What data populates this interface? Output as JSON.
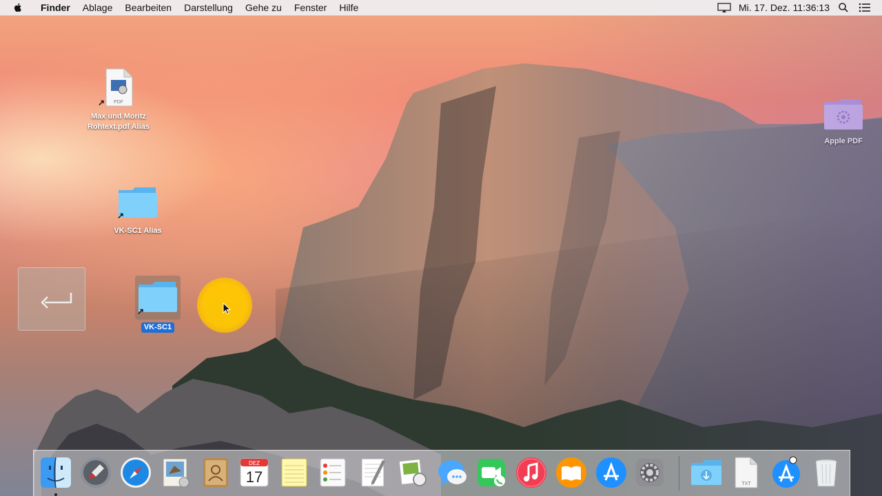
{
  "menubar": {
    "apple_icon": "apple-logo-icon",
    "items": [
      "Finder",
      "Ablage",
      "Bearbeiten",
      "Darstellung",
      "Gehe zu",
      "Fenster",
      "Hilfe"
    ],
    "clock": "Mi. 17. Dez.  11:36:13"
  },
  "desktop": {
    "pdf_alias": {
      "label": "Max und Moritz\nRohtext.pdf Alias",
      "badge": "PDF"
    },
    "folder_alias": {
      "label": "VK-SC1 Alias"
    },
    "folder_selected": {
      "label": "VK-SC1"
    },
    "apple_pdf": {
      "label": "Apple PDF"
    }
  },
  "dock": {
    "calendar_month": "DEZ",
    "calendar_day": "17",
    "txt_badge": "TXT",
    "items": [
      "Finder",
      "Launchpad",
      "Safari",
      "Mail",
      "Kontakte",
      "Kalender",
      "Notizen",
      "Erinnerungen",
      "TextEdit",
      "Vorschau",
      "Nachrichten",
      "FaceTime",
      "iTunes",
      "iBooks",
      "App Store",
      "Systemeinstellungen",
      "Downloads",
      "Dokument",
      "Programme",
      "Papierkorb"
    ]
  },
  "colors": {
    "selection": "#1f6fd6",
    "folder_blue": "#6ec6f5",
    "halo": "#ffc400"
  }
}
